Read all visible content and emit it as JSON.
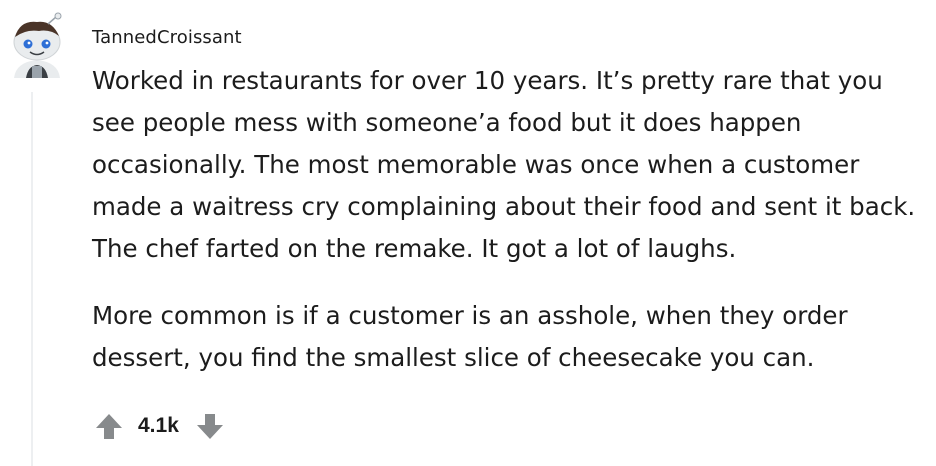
{
  "comment": {
    "author": "TannedCroissant",
    "paragraphs": [
      "Worked in restaurants for over 10 years. It’s pretty rare that you see people mess with someone’a food but it does happen occasionally. The most memorable was once when a customer made a waitress cry complaining about their food and sent it back. The chef farted on the remake. It got a lot of laughs.",
      "More common is if a customer is an asshole, when they order dessert, you find the smallest slice of cheesecake you can."
    ],
    "score": "4.1k"
  },
  "icons": {
    "avatar": "snoo-avatar-icon",
    "upvote": "upvote-arrow-icon",
    "downvote": "downvote-arrow-icon"
  },
  "colors": {
    "text": "#1c1c1c",
    "vote_arrow": "#878a8c",
    "thread_line": "#edeff1"
  }
}
